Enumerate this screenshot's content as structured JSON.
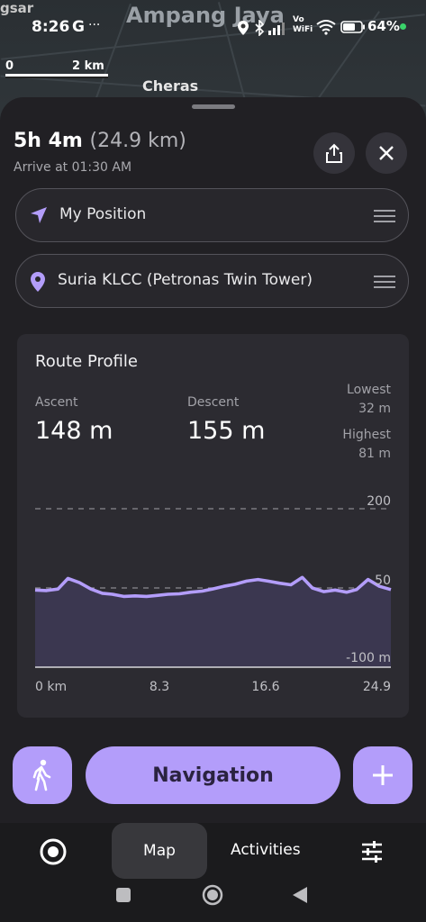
{
  "status": {
    "time": "8:26",
    "g": "G",
    "dots": "···",
    "vo": "Vo",
    "wifi_text": "WiFi",
    "battery": "64%"
  },
  "map": {
    "label_ampang": "Ampang Jaya",
    "label_cheras": "Cheras",
    "label_gsar": "gsar",
    "scale_zero": "0",
    "scale_value": "2 km"
  },
  "route": {
    "duration": "5h 4m",
    "distance": "(24.9 km)",
    "arrive": "Arrive at 01:30 AM",
    "from": "My Position",
    "to": "Suria KLCC (Petronas Twin Tower)"
  },
  "profile": {
    "title": "Route Profile",
    "ascent_label": "Ascent",
    "ascent_value": "148 m",
    "descent_label": "Descent",
    "descent_value": "155 m",
    "lowest_label": "Lowest",
    "lowest_value": "32 m",
    "highest_label": "Highest",
    "highest_value": "81 m"
  },
  "chart_data": {
    "type": "area",
    "x_ticks": [
      "0 km",
      "8.3",
      "16.6",
      "24.9"
    ],
    "y_ticks": [
      "200",
      "50",
      "-100 m"
    ],
    "ylim": [
      -100,
      200
    ],
    "xlim": [
      0,
      24.9
    ],
    "x": [
      0,
      0.8,
      1.6,
      2.3,
      3.1,
      3.9,
      4.7,
      5.4,
      6.2,
      7.0,
      7.8,
      8.6,
      9.3,
      10.1,
      10.9,
      11.7,
      12.4,
      13.2,
      14.0,
      14.8,
      15.6,
      16.3,
      17.1,
      17.9,
      18.7,
      19.4,
      20.2,
      21.0,
      21.8,
      22.5,
      23.3,
      24.1,
      24.9
    ],
    "y": [
      46,
      45,
      48,
      68,
      60,
      48,
      40,
      38,
      34,
      35,
      34,
      36,
      38,
      39,
      42,
      44,
      48,
      53,
      57,
      63,
      66,
      63,
      59,
      56,
      70,
      50,
      43,
      46,
      42,
      47,
      66,
      53,
      47
    ],
    "grid": "dashed lines at 200 and 50",
    "colors": {
      "line": "#b39dfa",
      "fill": "#3b3750"
    }
  },
  "actions": {
    "navigation": "Navigation",
    "plus": "+"
  },
  "tabs": {
    "map": "Map",
    "activities": "Activities"
  }
}
